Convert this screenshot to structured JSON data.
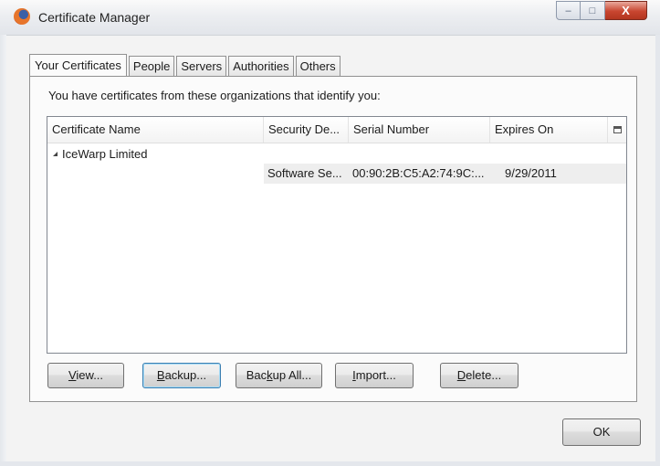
{
  "window": {
    "title": "Certificate Manager",
    "icon": "firefox-icon",
    "controls": {
      "minimize": "–",
      "maximize": "□",
      "close": "X"
    }
  },
  "tabs": [
    {
      "label": "Your Certificates",
      "active": true
    },
    {
      "label": "People",
      "active": false
    },
    {
      "label": "Servers",
      "active": false
    },
    {
      "label": "Authorities",
      "active": false
    },
    {
      "label": "Others",
      "active": false
    }
  ],
  "panel": {
    "intro_text": "You have certificates from these organizations that identify you:"
  },
  "tree": {
    "columns": [
      "Certificate Name",
      "Security De...",
      "Serial Number",
      "Expires On"
    ],
    "column_picker_icon": "column-picker-icon",
    "organizations": [
      {
        "name": "IceWarp Limited",
        "expanded": true,
        "certificates": [
          {
            "name": "",
            "security_device": "Software Se...",
            "serial_number": "00:90:2B:C5:A2:74:9C:...",
            "expires_on": "9/29/2011"
          }
        ]
      }
    ]
  },
  "buttons": [
    {
      "label_before": "",
      "accel": "V",
      "label_after": "iew...",
      "default": false
    },
    {
      "label_before": "",
      "accel": "B",
      "label_after": "ackup...",
      "default": true
    },
    {
      "label_before": "Bac",
      "accel": "k",
      "label_after": "up All...",
      "default": false
    },
    {
      "label_before": "",
      "accel": "I",
      "label_after": "mport...",
      "default": false
    },
    {
      "label_before": "",
      "accel": "D",
      "label_after": "elete...",
      "default": false
    }
  ],
  "ok_button": {
    "label": "OK"
  }
}
